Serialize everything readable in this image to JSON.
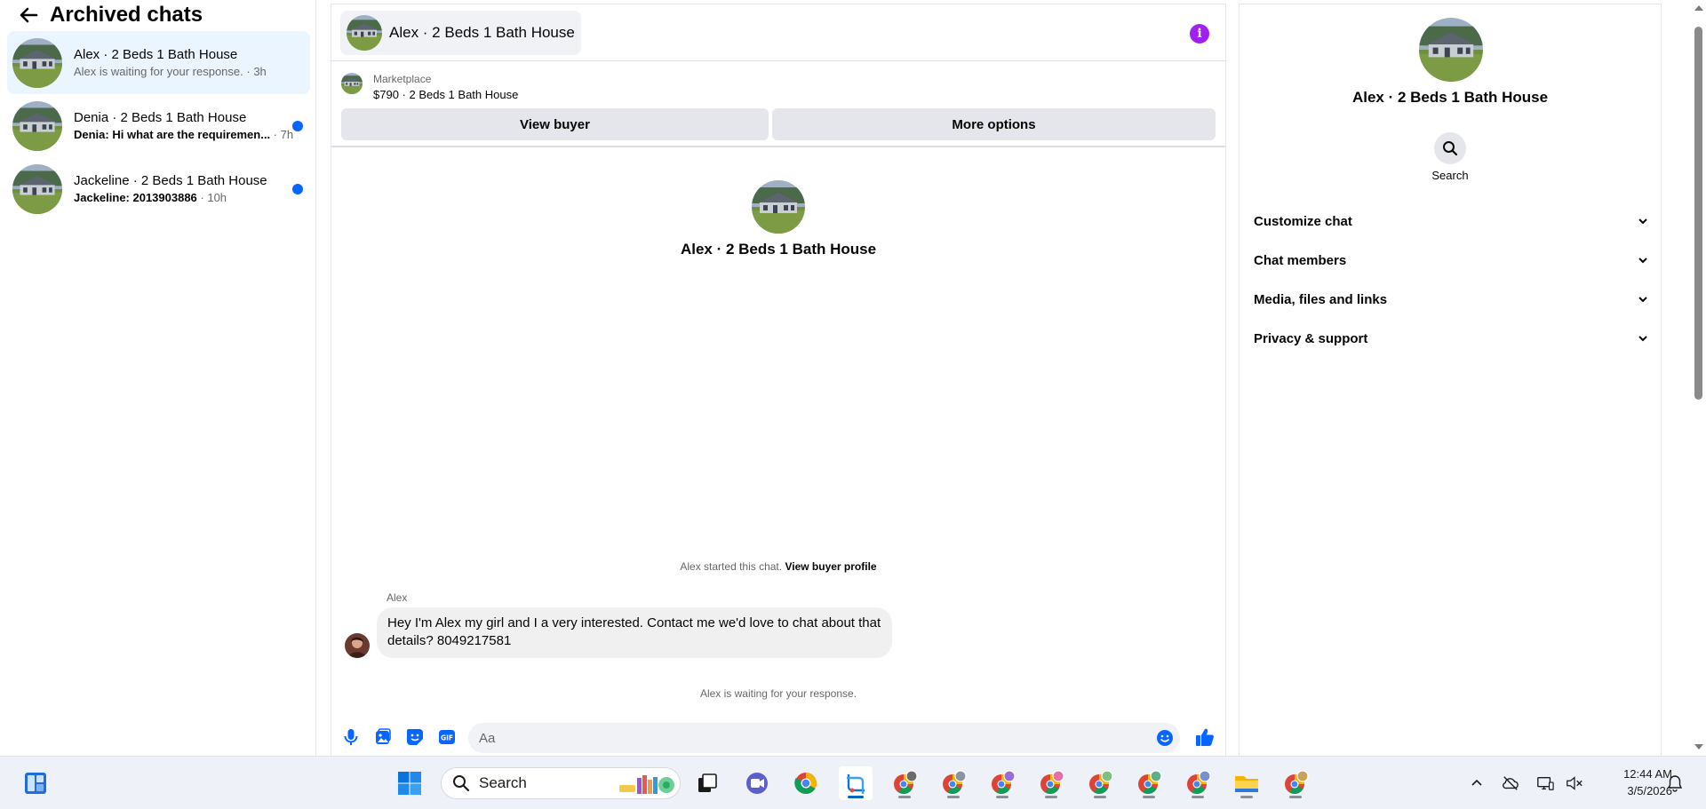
{
  "sidebar": {
    "title": "Archived chats",
    "chats": [
      {
        "name": "Alex · 2 Beds 1 Bath House",
        "preview": "Alex is waiting for your response.",
        "time": " · 3h",
        "unread": false,
        "active": true
      },
      {
        "name": "Denia · 2 Beds 1 Bath House",
        "preview": "Denia: Hi what are the requiremen...",
        "time": " · 7h",
        "unread": true,
        "active": false
      },
      {
        "name": "Jackeline · 2 Beds 1 Bath House",
        "preview": "Jackeline: 2013903886",
        "time": " · 10h",
        "unread": true,
        "active": false
      }
    ]
  },
  "header": {
    "title": "Alex · 2 Beds 1 Bath House",
    "info_icon": "info-icon",
    "accent_color": "#a020f0"
  },
  "marketplace": {
    "label": "Marketplace",
    "listing": "$790 · 2 Beds 1 Bath House",
    "view_buyer_label": "View buyer",
    "more_options_label": "More options"
  },
  "conversation": {
    "intro_name": "Alex · 2 Beds 1 Bath House",
    "started_text": "Alex started this chat.",
    "profile_link": "View buyer profile",
    "sender": "Alex",
    "messages": [
      {
        "text": "Hey I'm Alex my girl and I a very interested. Contact me we'd love to chat about that details? 8049217581"
      }
    ],
    "waiting_text": "Alex is waiting for your response."
  },
  "composer": {
    "placeholder": "Aa",
    "icons": [
      "microphone-icon",
      "image-icon",
      "sticker-icon",
      "gif-icon",
      "emoji-icon",
      "thumbs-up-icon"
    ],
    "accent_color": "#0866ff"
  },
  "info_panel": {
    "name": "Alex · 2 Beds 1 Bath House",
    "search_label": "Search",
    "sections": [
      "Customize chat",
      "Chat members",
      "Media, files and links",
      "Privacy & support"
    ]
  },
  "taskbar": {
    "search_label": "Search",
    "time": "12:44 AM",
    "date": "3/5/2026"
  }
}
